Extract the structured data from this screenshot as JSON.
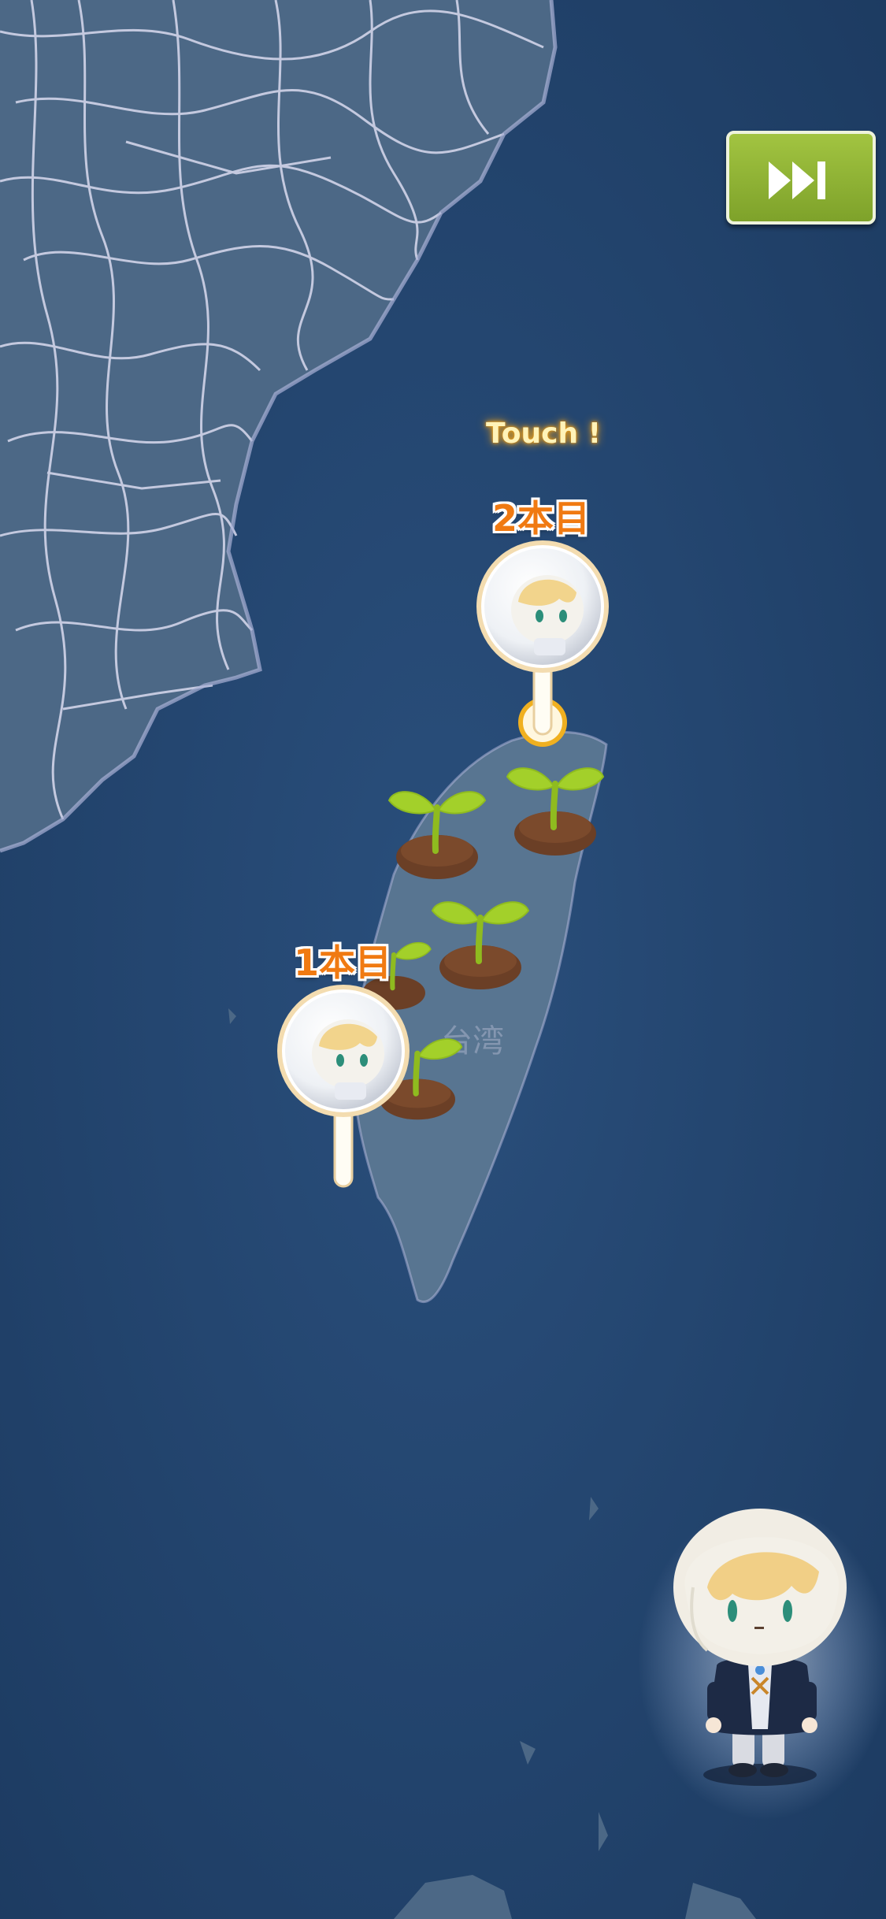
{
  "screen": {
    "touch_prompt": "Touch !",
    "skip_icon": "fast-forward-icon",
    "markers": [
      {
        "label": "2本目"
      },
      {
        "label": "1本目"
      }
    ],
    "map_label": "台湾",
    "colors": {
      "ocean": "#23456e",
      "land": "#4d6a88",
      "roads": "#d9dbef",
      "skip_button": "#8fb332",
      "label_orange": "#f07a12",
      "touch_glow": "#f0a31a",
      "sprout_leaf": "#9ccb28",
      "soil": "#6b3f26"
    }
  }
}
